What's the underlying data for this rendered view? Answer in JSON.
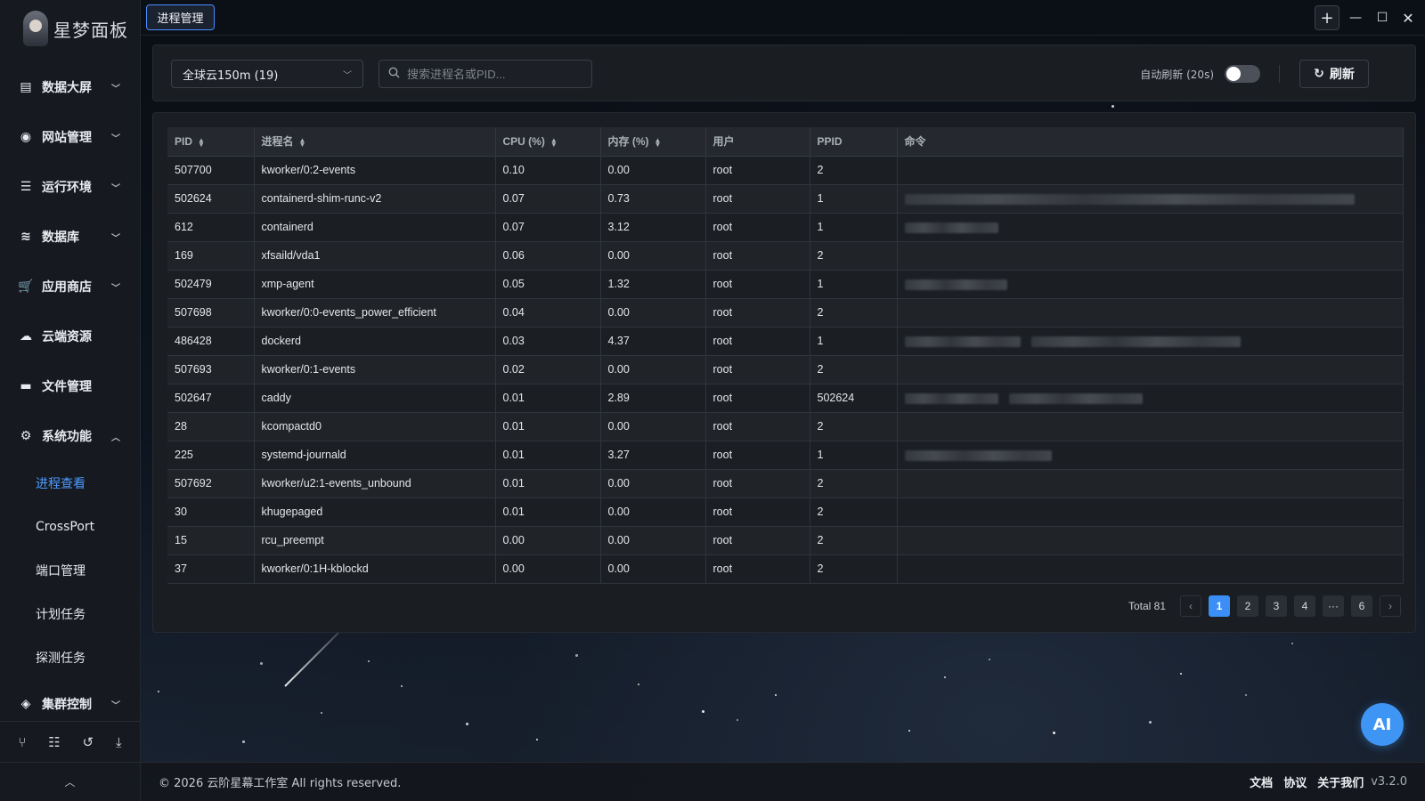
{
  "app": {
    "logo_text": "星梦面板",
    "tab_label": "进程管理"
  },
  "sidebar": {
    "items": [
      {
        "label": "数据大屏",
        "icon": "bar-chart-icon",
        "expandable": true
      },
      {
        "label": "网站管理",
        "icon": "globe-icon",
        "expandable": true
      },
      {
        "label": "运行环境",
        "icon": "server-icon",
        "expandable": true
      },
      {
        "label": "数据库",
        "icon": "database-icon",
        "expandable": true
      },
      {
        "label": "应用商店",
        "icon": "cart-icon",
        "expandable": true
      },
      {
        "label": "云端资源",
        "icon": "cloud-icon",
        "expandable": false
      },
      {
        "label": "文件管理",
        "icon": "folder-icon",
        "expandable": false
      },
      {
        "label": "系统功能",
        "icon": "gears-icon",
        "expandable": true,
        "expanded": true
      }
    ],
    "sub_items": [
      {
        "label": "进程查看",
        "active": true
      },
      {
        "label": "CrossPort",
        "active": false
      },
      {
        "label": "端口管理",
        "active": false
      },
      {
        "label": "计划任务",
        "active": false
      },
      {
        "label": "探测任务",
        "active": false
      }
    ],
    "last_item": {
      "label": "集群控制",
      "icon": "layers-icon"
    },
    "tools": [
      "branch-icon",
      "list-icon",
      "history-icon",
      "download-icon"
    ]
  },
  "filter": {
    "server_select": "全球云150m (19)",
    "search_placeholder": "搜索进程名或PID...",
    "auto_refresh_label": "自动刷新 (20s)",
    "auto_refresh_on": false,
    "refresh_label": "刷新"
  },
  "table": {
    "columns": [
      "PID",
      "进程名",
      "CPU (%)",
      "内存 (%)",
      "用户",
      "PPID",
      "命令"
    ],
    "sortable": [
      true,
      true,
      true,
      true,
      false,
      false,
      false
    ],
    "rows": [
      {
        "pid": "507700",
        "name": "kworker/0:2-events",
        "cpu": "0.10",
        "mem": "0.00",
        "user": "root",
        "ppid": "2",
        "cmd_hidden": false
      },
      {
        "pid": "502624",
        "name": "containerd-shim-runc-v2",
        "cpu": "0.07",
        "mem": "0.73",
        "user": "root",
        "ppid": "1",
        "cmd_hidden": true
      },
      {
        "pid": "612",
        "name": "containerd",
        "cpu": "0.07",
        "mem": "3.12",
        "user": "root",
        "ppid": "1",
        "cmd_hidden": true
      },
      {
        "pid": "169",
        "name": "xfsaild/vda1",
        "cpu": "0.06",
        "mem": "0.00",
        "user": "root",
        "ppid": "2",
        "cmd_hidden": false
      },
      {
        "pid": "502479",
        "name": "xmp-agent",
        "cpu": "0.05",
        "mem": "1.32",
        "user": "root",
        "ppid": "1",
        "cmd_hidden": true
      },
      {
        "pid": "507698",
        "name": "kworker/0:0-events_power_efficient",
        "cpu": "0.04",
        "mem": "0.00",
        "user": "root",
        "ppid": "2",
        "cmd_hidden": false
      },
      {
        "pid": "486428",
        "name": "dockerd",
        "cpu": "0.03",
        "mem": "4.37",
        "user": "root",
        "ppid": "1",
        "cmd_hidden": true
      },
      {
        "pid": "507693",
        "name": "kworker/0:1-events",
        "cpu": "0.02",
        "mem": "0.00",
        "user": "root",
        "ppid": "2",
        "cmd_hidden": false
      },
      {
        "pid": "502647",
        "name": "caddy",
        "cpu": "0.01",
        "mem": "2.89",
        "user": "root",
        "ppid": "502624",
        "cmd_hidden": true
      },
      {
        "pid": "28",
        "name": "kcompactd0",
        "cpu": "0.01",
        "mem": "0.00",
        "user": "root",
        "ppid": "2",
        "cmd_hidden": false
      },
      {
        "pid": "225",
        "name": "systemd-journald",
        "cpu": "0.01",
        "mem": "3.27",
        "user": "root",
        "ppid": "1",
        "cmd_hidden": true
      },
      {
        "pid": "507692",
        "name": "kworker/u2:1-events_unbound",
        "cpu": "0.01",
        "mem": "0.00",
        "user": "root",
        "ppid": "2",
        "cmd_hidden": false
      },
      {
        "pid": "30",
        "name": "khugepaged",
        "cpu": "0.01",
        "mem": "0.00",
        "user": "root",
        "ppid": "2",
        "cmd_hidden": false
      },
      {
        "pid": "15",
        "name": "rcu_preempt",
        "cpu": "0.00",
        "mem": "0.00",
        "user": "root",
        "ppid": "2",
        "cmd_hidden": false
      },
      {
        "pid": "37",
        "name": "kworker/0:1H-kblockd",
        "cpu": "0.00",
        "mem": "0.00",
        "user": "root",
        "ppid": "2",
        "cmd_hidden": false
      }
    ]
  },
  "pagination": {
    "total_label": "Total 81",
    "pages": [
      "1",
      "2",
      "3",
      "4",
      "···",
      "6"
    ],
    "current": "1"
  },
  "footer": {
    "copyright": "© 2026 云阶星幕工作室 All rights reserved.",
    "links": [
      "文档",
      "协议",
      "关于我们"
    ],
    "version": "v3.2.0"
  },
  "ai_button": "AI",
  "colors": {
    "accent": "#3a8ef6",
    "active_nav": "#4d9bff",
    "tab_border": "#4a8cff"
  }
}
